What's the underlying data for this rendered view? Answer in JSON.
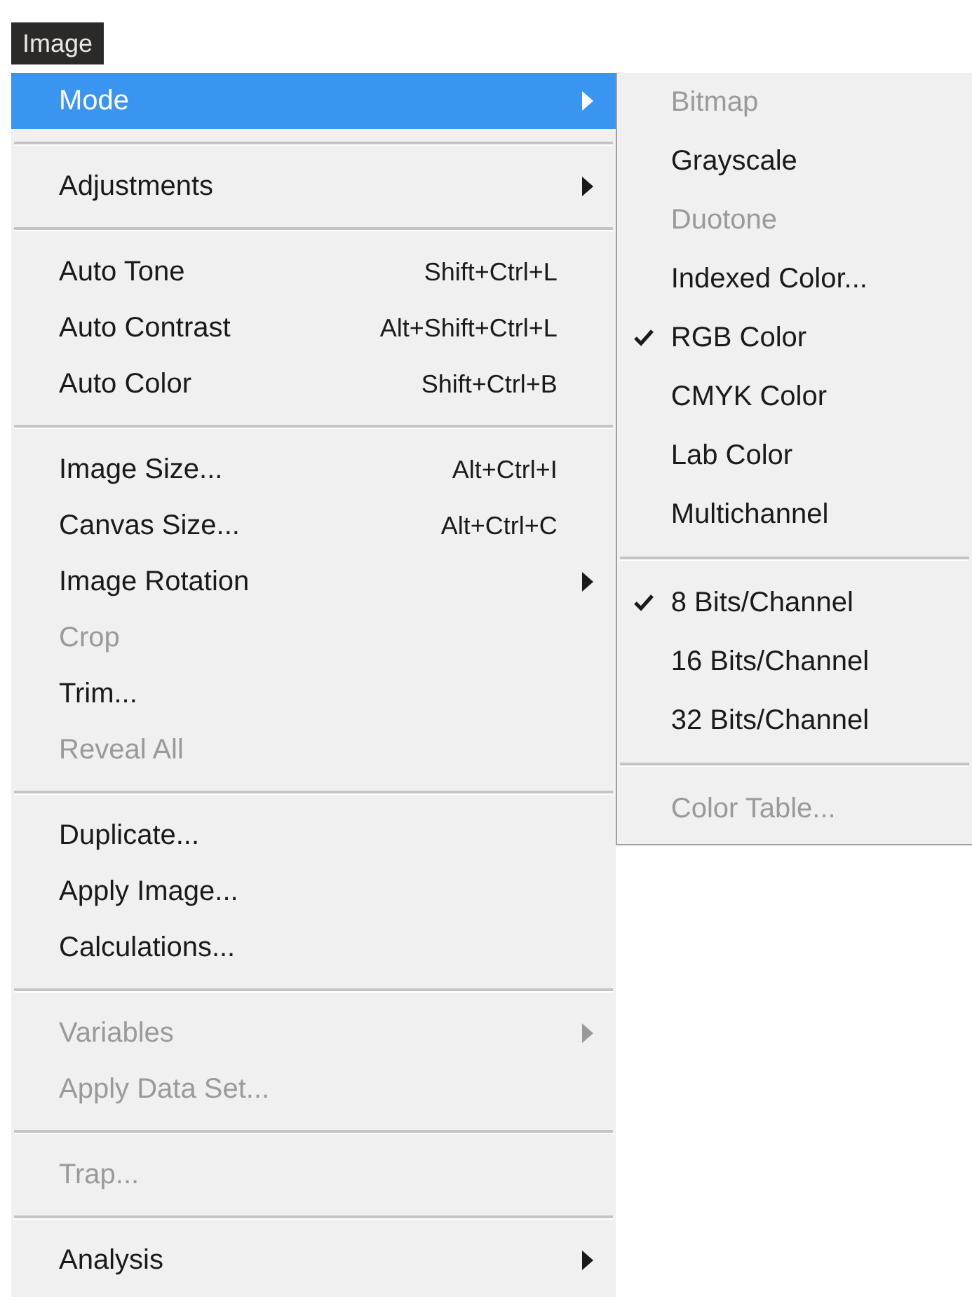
{
  "menu_title": "Image",
  "menu": {
    "sections": [
      [
        {
          "label": "Mode",
          "submenu": true,
          "disabled": false,
          "selected": true
        }
      ],
      [
        {
          "label": "Adjustments",
          "submenu": true,
          "disabled": false,
          "selected": false
        }
      ],
      [
        {
          "label": "Auto Tone",
          "shortcut": "Shift+Ctrl+L",
          "submenu": false,
          "disabled": false,
          "selected": false
        },
        {
          "label": "Auto Contrast",
          "shortcut": "Alt+Shift+Ctrl+L",
          "submenu": false,
          "disabled": false,
          "selected": false
        },
        {
          "label": "Auto Color",
          "shortcut": "Shift+Ctrl+B",
          "submenu": false,
          "disabled": false,
          "selected": false
        }
      ],
      [
        {
          "label": "Image Size...",
          "shortcut": "Alt+Ctrl+I",
          "submenu": false,
          "disabled": false,
          "selected": false
        },
        {
          "label": "Canvas Size...",
          "shortcut": "Alt+Ctrl+C",
          "submenu": false,
          "disabled": false,
          "selected": false
        },
        {
          "label": "Image Rotation",
          "submenu": true,
          "disabled": false,
          "selected": false
        },
        {
          "label": "Crop",
          "submenu": false,
          "disabled": true,
          "selected": false
        },
        {
          "label": "Trim...",
          "submenu": false,
          "disabled": false,
          "selected": false
        },
        {
          "label": "Reveal All",
          "submenu": false,
          "disabled": true,
          "selected": false
        }
      ],
      [
        {
          "label": "Duplicate...",
          "submenu": false,
          "disabled": false,
          "selected": false
        },
        {
          "label": "Apply Image...",
          "submenu": false,
          "disabled": false,
          "selected": false
        },
        {
          "label": "Calculations...",
          "submenu": false,
          "disabled": false,
          "selected": false
        }
      ],
      [
        {
          "label": "Variables",
          "submenu": true,
          "disabled": true,
          "selected": false
        },
        {
          "label": "Apply Data Set...",
          "submenu": false,
          "disabled": true,
          "selected": false
        }
      ],
      [
        {
          "label": "Trap...",
          "submenu": false,
          "disabled": true,
          "selected": false
        }
      ],
      [
        {
          "label": "Analysis",
          "submenu": true,
          "disabled": false,
          "selected": false
        }
      ]
    ]
  },
  "submenu": {
    "sections": [
      [
        {
          "label": "Bitmap",
          "checked": false,
          "disabled": true
        },
        {
          "label": "Grayscale",
          "checked": false,
          "disabled": false
        },
        {
          "label": "Duotone",
          "checked": false,
          "disabled": true
        },
        {
          "label": "Indexed Color...",
          "checked": false,
          "disabled": false
        },
        {
          "label": "RGB Color",
          "checked": true,
          "disabled": false
        },
        {
          "label": "CMYK Color",
          "checked": false,
          "disabled": false
        },
        {
          "label": "Lab Color",
          "checked": false,
          "disabled": false
        },
        {
          "label": "Multichannel",
          "checked": false,
          "disabled": false
        }
      ],
      [
        {
          "label": "8 Bits/Channel",
          "checked": true,
          "disabled": false
        },
        {
          "label": "16 Bits/Channel",
          "checked": false,
          "disabled": false
        },
        {
          "label": "32 Bits/Channel",
          "checked": false,
          "disabled": false
        }
      ],
      [
        {
          "label": "Color Table...",
          "checked": false,
          "disabled": true
        }
      ]
    ]
  }
}
